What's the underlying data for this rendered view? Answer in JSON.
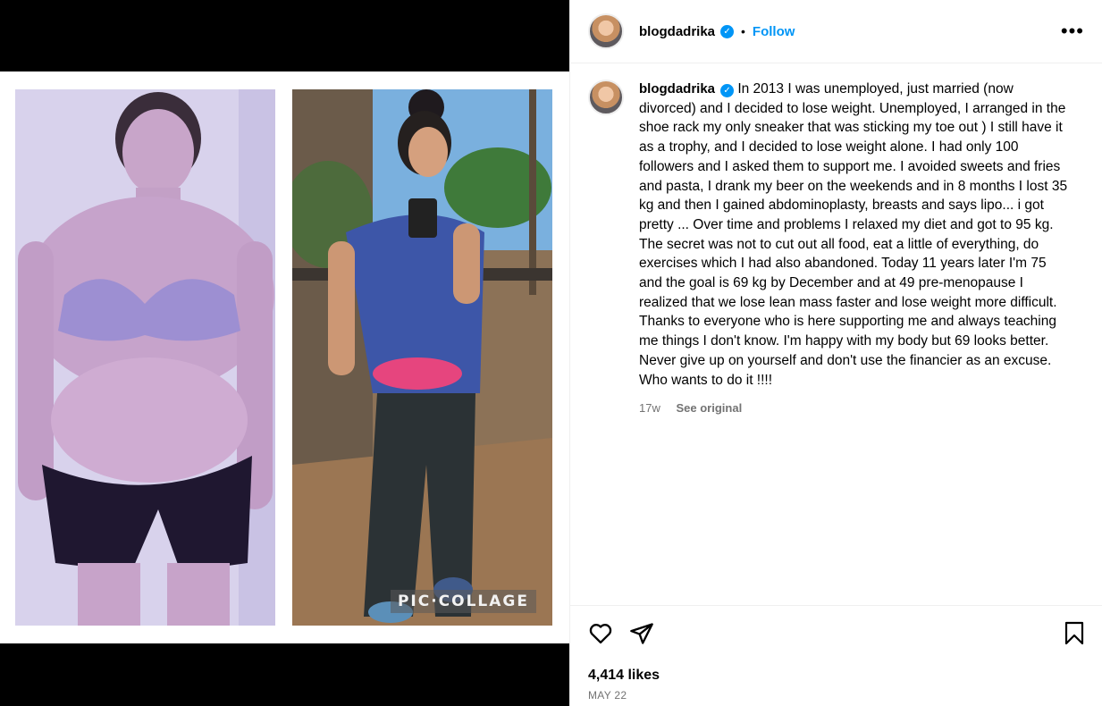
{
  "post": {
    "username": "blogdadrika",
    "follow_label": "Follow",
    "more_label": "•••",
    "caption": "In 2013 I was unemployed, just married (now divorced) and I decided to lose weight. Unemployed, I arranged in the shoe rack my only sneaker that was sticking my toe out ) I still have it as a trophy, and I decided to lose weight alone. I had only 100 followers and I asked them to support me. I avoided sweets and fries and pasta, I drank my beer on the weekends and in 8 months I lost 35 kg and then I gained abdominoplasty, breasts and says lipo... i got pretty ... Over time and problems I relaxed my diet and got to 95 kg. The secret was not to cut out all food, eat a little of everything, do exercises which I had also abandoned. Today 11 years later I'm 75 and the goal is 69 kg by December and at 49 pre-menopause I realized that we lose lean mass faster and lose weight more difficult. Thanks to everyone who is here supporting me and always teaching me things I don't know. I'm happy with my body but 69 looks better. Never give up on yourself and don't use the financier as an excuse. Who wants to do it !!!!",
    "time_ago": "17w",
    "see_original": "See original",
    "likes": "4,414 likes",
    "date": "MAY 22"
  },
  "media": {
    "watermark": "PIC·COLLAGE"
  },
  "icons": {
    "verified": "verified-badge-icon",
    "like": "heart-icon",
    "share": "paper-plane-icon",
    "save": "bookmark-icon",
    "more": "more-options-icon"
  },
  "colors": {
    "accent": "#0095f6",
    "muted": "#737373",
    "border": "#efefef"
  }
}
